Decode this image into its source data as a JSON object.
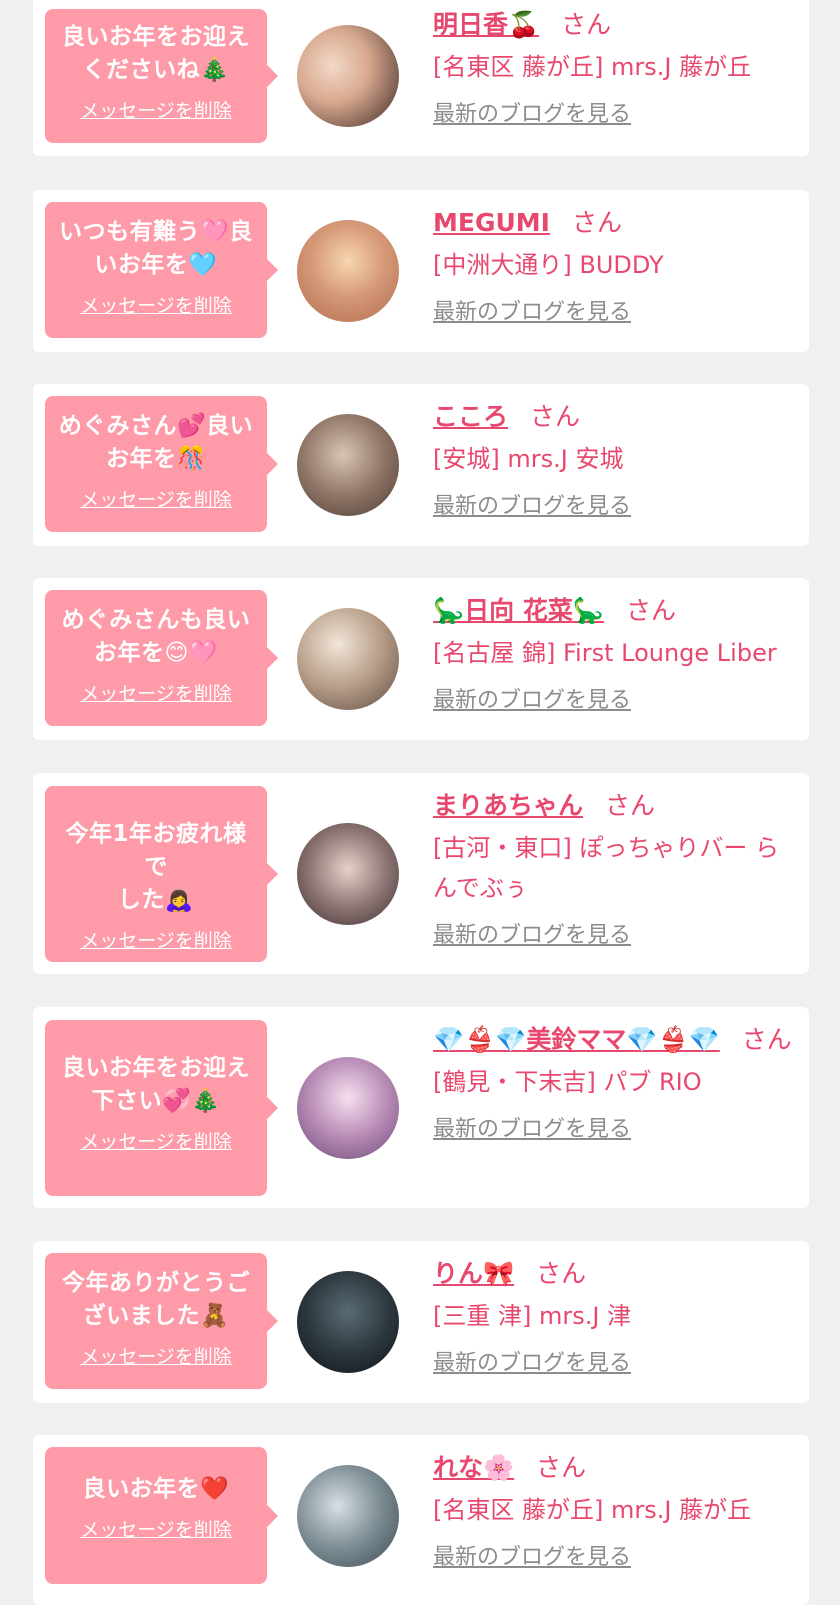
{
  "items": [
    {
      "message": "良いお年をお迎え\nくださいね🎄",
      "delete_label": "メッセージを削除",
      "name": "明日香🍒",
      "san": "さん",
      "shop": "[名東区 藤が丘] mrs.J 藤が丘",
      "blog_label": "最新のブログを見る",
      "avatar_colors": [
        "#f2d9c9",
        "#3a2522"
      ]
    },
    {
      "message": "いつも有難う🩷良\nいお年を🩵",
      "delete_label": "メッセージを削除",
      "name": "MEGUMI",
      "san": "さん",
      "shop": "[中洲大通り] BUDDY",
      "blog_label": "最新のブログを見る",
      "avatar_colors": [
        "#f6d6b0",
        "#b06b4c"
      ]
    },
    {
      "message": "めぐみさん💕良い\nお年を🎊",
      "delete_label": "メッセージを削除",
      "name": "こころ",
      "san": "さん",
      "shop": "[安城] mrs.J 安城",
      "blog_label": "最新のブログを見る",
      "avatar_colors": [
        "#d9c4b2",
        "#4a3a34"
      ]
    },
    {
      "message": "めぐみさんも良い\nお年を😊🩷",
      "delete_label": "メッセージを削除",
      "name": "🦕日向 花菜🦕",
      "san": "さん",
      "shop": "[名古屋 錦] First Lounge Liber",
      "blog_label": "最新のブログを見る",
      "avatar_colors": [
        "#e8d6c2",
        "#5a4a44"
      ]
    },
    {
      "message": "今年1年お疲れ様で\nした🙇‍♀️",
      "delete_label": "メッセージを削除",
      "name": "まりあちゃん",
      "san": "さん",
      "shop": "[古河・東口] ぽっちゃりバー らんでぶぅ",
      "blog_label": "最新のブログを見る",
      "avatar_colors": [
        "#c8b2ac",
        "#3c2e33"
      ]
    },
    {
      "message": "良いお年をお迎え\n下さい💞🎄",
      "delete_label": "メッセージを削除",
      "name": "💎👙💎美鈴ママ💎👙💎",
      "san": "さん",
      "shop": "[鶴見・下末吉] パブ RIO",
      "blog_label": "最新のブログを見る",
      "avatar_colors": [
        "#e9c5e0",
        "#6b4a7a"
      ]
    },
    {
      "message": "今年ありがとうご\nざいました🧸",
      "delete_label": "メッセージを削除",
      "name": "りん🎀",
      "san": "さん",
      "shop": "[三重 津] mrs.J 津",
      "blog_label": "最新のブログを見る",
      "avatar_colors": [
        "#3a4a52",
        "#101418"
      ]
    },
    {
      "message": "良いお年を❤️",
      "delete_label": "メッセージを削除",
      "name": "れな🌸",
      "san": "さん",
      "shop": "[名東区 藤が丘] mrs.J 藤が丘",
      "blog_label": "最新のブログを見る",
      "avatar_colors": [
        "#b9c3c8",
        "#3b4a50"
      ]
    }
  ]
}
